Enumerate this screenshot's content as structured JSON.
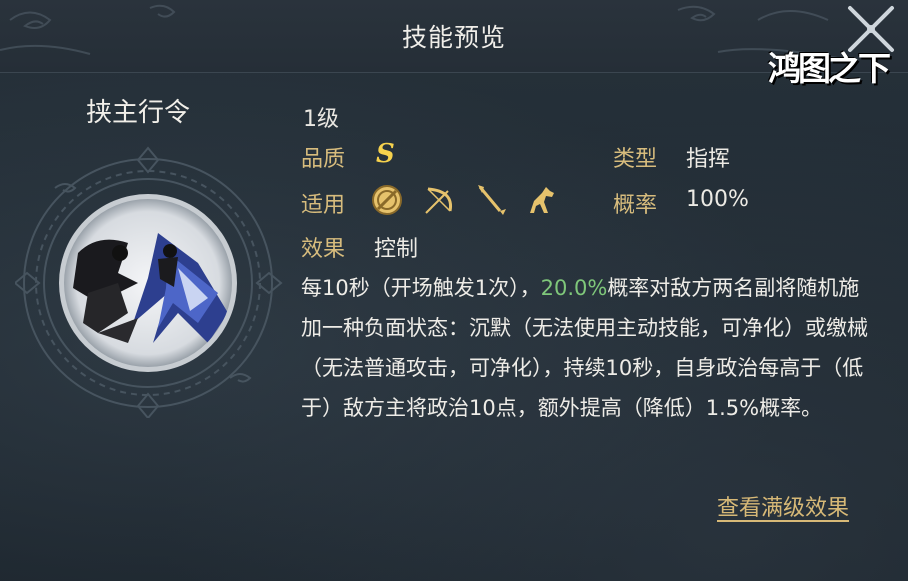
{
  "header": {
    "title": "技能预览",
    "logo_text": "鸿图之下"
  },
  "skill": {
    "name": "挟主行令",
    "level": "1级",
    "quality_label": "品质",
    "quality_value": "S",
    "type_label": "类型",
    "type_value": "指挥",
    "applicable_label": "适用",
    "applicable_icons": [
      "shield-icon",
      "bow-icon",
      "spear-icon",
      "horse-icon"
    ],
    "chance_label": "概率",
    "chance_value": "100%",
    "effect_label": "效果",
    "effect_value": "控制",
    "description": {
      "pre": "每10秒（开场触发1次），",
      "highlight": "20.0%",
      "post": "概率对敌方两名副将随机施加一种负面状态：沉默（无法使用主动技能，可净化）或缴械（无法普通攻击，可净化），持续10秒，自身政治每高于（低于）敌方主将政治10点，额外提高（降低）1.5%概率。"
    },
    "highlight_color": "#7fc77a"
  },
  "actions": {
    "view_max_level": "查看满级效果"
  },
  "colors": {
    "label": "#d7bc7d",
    "grade": "#f6d24d",
    "background": "#1f2830"
  }
}
